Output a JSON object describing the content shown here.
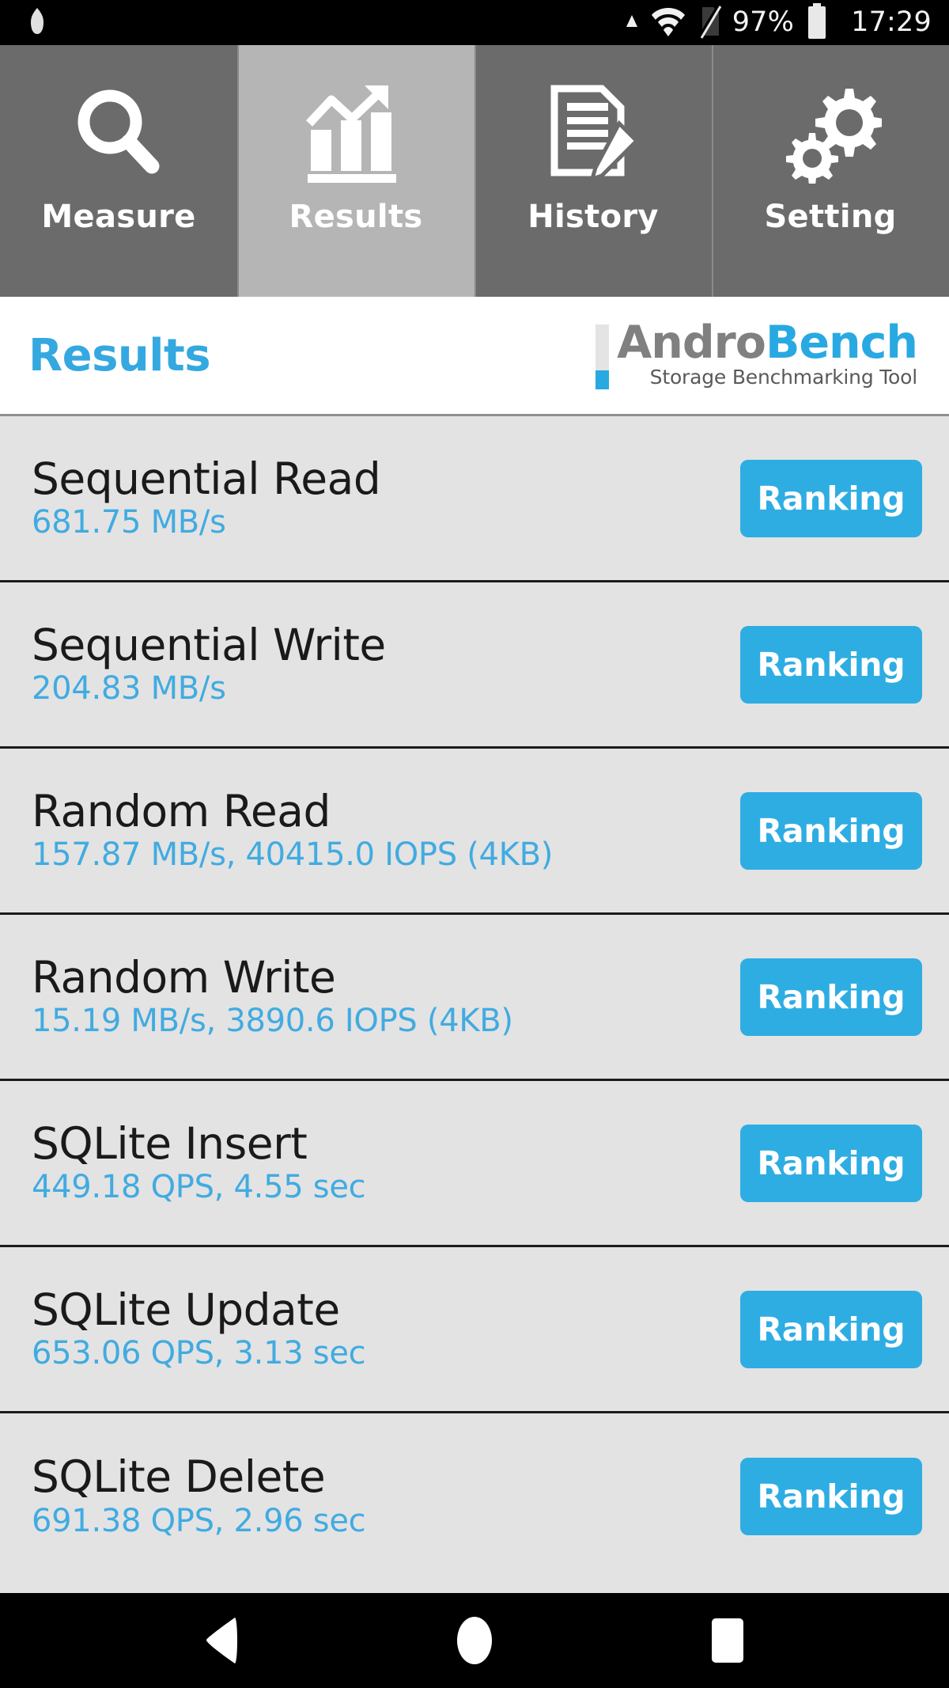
{
  "status_bar": {
    "notification_icon": "app-notification-icon",
    "signal_icon": "signal-triangle-icon",
    "wifi_icon": "wifi-icon",
    "sim_icon": "no-sim-icon",
    "battery_percent": "97%",
    "battery_icon": "battery-full-icon",
    "clock": "17:29"
  },
  "tabs": [
    {
      "label": "Measure",
      "icon": "magnifier-icon",
      "active": false
    },
    {
      "label": "Results",
      "icon": "bar-chart-arrow-icon",
      "active": true
    },
    {
      "label": "History",
      "icon": "document-pencil-icon",
      "active": false
    },
    {
      "label": "Setting",
      "icon": "gears-icon",
      "active": false
    }
  ],
  "header": {
    "title": "Results",
    "logo": {
      "word_1": "Andro",
      "word_2": "Bench",
      "subtitle": "Storage Benchmarking Tool",
      "color_gray": "#808080",
      "color_blue": "#29a9e1"
    }
  },
  "results": {
    "ranking_button_label": "Ranking",
    "rows": [
      {
        "title": "Sequential Read",
        "value": "681.75 MB/s"
      },
      {
        "title": "Sequential Write",
        "value": "204.83 MB/s"
      },
      {
        "title": "Random Read",
        "value": "157.87 MB/s, 40415.0 IOPS (4KB)"
      },
      {
        "title": "Random Write",
        "value": "15.19 MB/s, 3890.6 IOPS (4KB)"
      },
      {
        "title": "SQLite Insert",
        "value": "449.18 QPS, 4.55 sec"
      },
      {
        "title": "SQLite Update",
        "value": "653.06 QPS, 3.13 sec"
      },
      {
        "title": "SQLite Delete",
        "value": "691.38 QPS, 2.96 sec"
      }
    ]
  },
  "nav_bar": {
    "back": "back-triangle-icon",
    "home": "home-circle-icon",
    "recents": "recents-square-icon"
  },
  "colors": {
    "accent_blue": "#29a9e1",
    "button_blue": "#2eade3",
    "value_blue": "#41abe1",
    "tab_inactive": "#6b6b6b",
    "tab_active": "#b5b5b5",
    "row_bg": "#e3e3e3"
  }
}
